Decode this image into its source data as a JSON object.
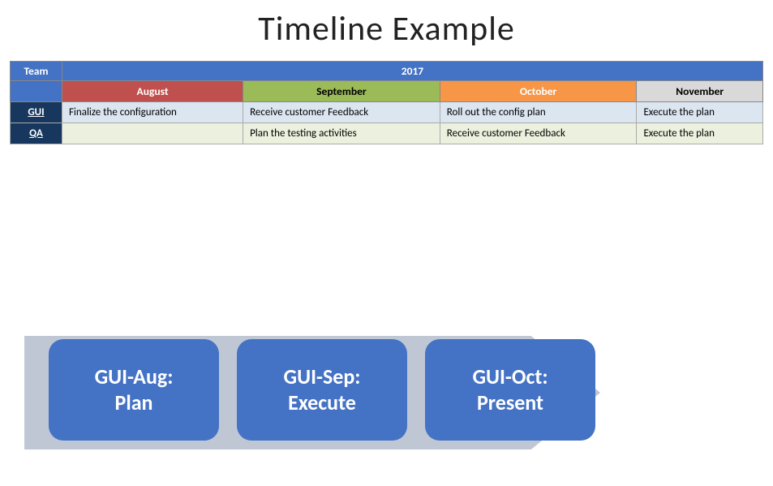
{
  "title": "Timeline Example",
  "table": {
    "year_label": "2017",
    "team_header": "Team",
    "months": [
      "August",
      "September",
      "October",
      "November"
    ],
    "rows": [
      {
        "team": "GUI",
        "cells": [
          "Finalize the configuration",
          "Receive customer Feedback",
          "Roll out the config plan",
          "Execute the plan"
        ]
      },
      {
        "team": "QA",
        "cells": [
          "",
          "Plan the testing activities",
          "Receive customer Feedback",
          "Execute the plan"
        ]
      }
    ]
  },
  "process": {
    "boxes": [
      {
        "label": "GUI-Aug:\nPlan"
      },
      {
        "label": "GUI-Sep:\nExecute"
      },
      {
        "label": "GUI-Oct:\nPresent"
      }
    ]
  }
}
